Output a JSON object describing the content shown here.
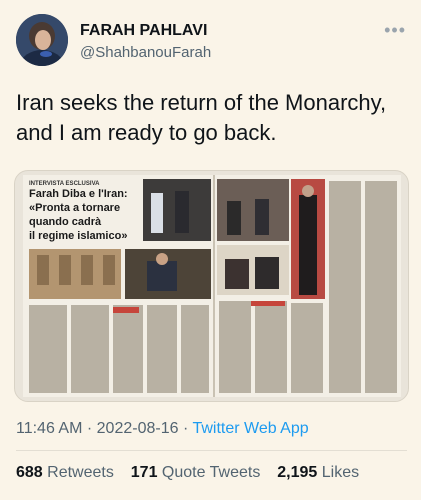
{
  "author": {
    "name": "FARAH PAHLAVI",
    "handle": "@ShahbanouFarah"
  },
  "tweet": {
    "text_line1": "Iran seeks the return of the Monarchy,",
    "text_line2": "and I am ready to go back."
  },
  "media": {
    "kicker": "INTERVISTA ESCLUSIVA",
    "headline_1": "Farah Diba e l'Iran:",
    "headline_2": "«Pronta a tornare",
    "headline_3": "quando cadrà",
    "headline_4": "il regime islamico»"
  },
  "meta": {
    "time": "11:46 AM",
    "date": "2022-08-16",
    "source": "Twitter Web App"
  },
  "stats": {
    "retweets_count": "688",
    "retweets_label": "Retweets",
    "quotes_count": "171",
    "quotes_label": "Quote Tweets",
    "likes_count": "2,195",
    "likes_label": "Likes"
  },
  "colors": {
    "background": "#faf4e8",
    "link": "#1d9bf0",
    "muted": "#536471"
  }
}
